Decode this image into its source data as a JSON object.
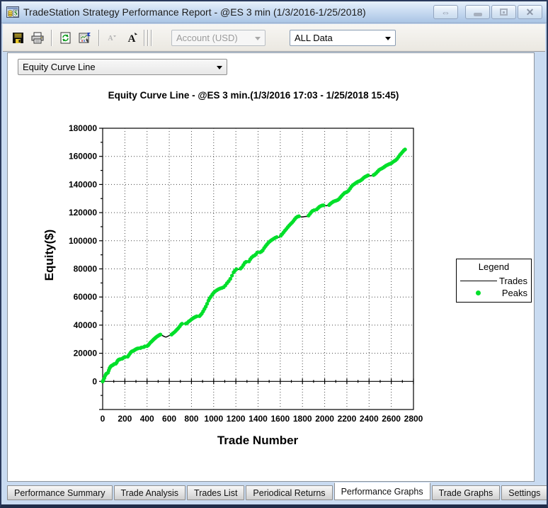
{
  "window": {
    "title": "TradeStation Strategy Performance Report - @ES 3 min (1/3/2016-1/25/2018)",
    "controls": [
      {
        "name": "dock-toggle",
        "icon": "left-right-arrow-icon",
        "glyph": "⇔"
      },
      {
        "name": "minimize",
        "icon": "minimize-icon"
      },
      {
        "name": "maximize",
        "icon": "maximize-icon"
      },
      {
        "name": "close",
        "icon": "close-icon",
        "glyph": "✕"
      }
    ]
  },
  "toolbar": {
    "buttons": [
      {
        "name": "save",
        "icon": "save-floppy-icon"
      },
      {
        "name": "print",
        "icon": "printer-icon"
      },
      {
        "name": "refresh",
        "icon": "refresh-page-icon"
      },
      {
        "name": "report-settings",
        "icon": "report-settings-icon"
      },
      {
        "name": "font-decrease",
        "icon": "font-decrease-icon",
        "disabled": true
      },
      {
        "name": "font-increase",
        "icon": "font-increase-icon"
      }
    ],
    "account_combo": {
      "value": "Account (USD)",
      "disabled": true
    },
    "range_combo": {
      "value": "ALL Data",
      "disabled": false
    }
  },
  "graph_selector": {
    "value": "Equity Curve Line"
  },
  "chart_data": {
    "type": "line",
    "title": "Equity Curve Line - @ES 3 min.(1/3/2016 17:03 - 1/25/2018 15:45)",
    "xlabel": "Trade Number",
    "ylabel": "Equity($)",
    "xlim": [
      0,
      2800
    ],
    "ylim": [
      -20000,
      180000
    ],
    "x_tick_step": 200,
    "x_minor_step": 100,
    "y_tick_step": 20000,
    "y_minor_step": 10000,
    "y_label_min": 0,
    "grid": "dotted",
    "grid_color": "#444444",
    "legend": {
      "title": "Legend",
      "position": "right-outside",
      "entries": [
        {
          "label": "Trades",
          "type": "line",
          "color": "#000000"
        },
        {
          "label": "Peaks",
          "type": "dot",
          "color": "#00df2a"
        }
      ]
    },
    "series": [
      {
        "name": "Trades",
        "type": "line",
        "color": "#000000",
        "points": [
          [
            0,
            0
          ],
          [
            8,
            1200
          ],
          [
            16,
            2600
          ],
          [
            24,
            4300
          ],
          [
            30,
            5200
          ],
          [
            36,
            5600
          ],
          [
            42,
            5100
          ],
          [
            48,
            6200
          ],
          [
            55,
            7800
          ],
          [
            62,
            9300
          ],
          [
            70,
            10400
          ],
          [
            78,
            11000
          ],
          [
            86,
            11400
          ],
          [
            95,
            11800
          ],
          [
            103,
            12300
          ],
          [
            110,
            12100
          ],
          [
            118,
            12600
          ],
          [
            126,
            13400
          ],
          [
            134,
            14600
          ],
          [
            142,
            15300
          ],
          [
            150,
            15600
          ],
          [
            158,
            15800
          ],
          [
            166,
            15700
          ],
          [
            175,
            16100
          ],
          [
            184,
            16600
          ],
          [
            193,
            17100
          ],
          [
            202,
            17300
          ],
          [
            210,
            16900
          ],
          [
            218,
            17000
          ],
          [
            226,
            17600
          ],
          [
            235,
            18600
          ],
          [
            244,
            19600
          ],
          [
            253,
            20600
          ],
          [
            262,
            21300
          ],
          [
            271,
            21600
          ],
          [
            280,
            21900
          ],
          [
            290,
            22400
          ],
          [
            300,
            22900
          ],
          [
            310,
            23300
          ],
          [
            320,
            23500
          ],
          [
            330,
            23100
          ],
          [
            340,
            23700
          ],
          [
            350,
            24100
          ],
          [
            360,
            23900
          ],
          [
            370,
            24400
          ],
          [
            380,
            24900
          ],
          [
            390,
            24600
          ],
          [
            400,
            25100
          ],
          [
            410,
            25700
          ],
          [
            420,
            26600
          ],
          [
            430,
            27600
          ],
          [
            440,
            28300
          ],
          [
            450,
            29100
          ],
          [
            460,
            29900
          ],
          [
            470,
            30600
          ],
          [
            480,
            31300
          ],
          [
            490,
            31900
          ],
          [
            500,
            32400
          ],
          [
            510,
            32900
          ],
          [
            520,
            33300
          ],
          [
            532,
            32900
          ],
          [
            545,
            32300
          ],
          [
            558,
            31800
          ],
          [
            570,
            31500
          ],
          [
            582,
            31900
          ],
          [
            595,
            32400
          ],
          [
            608,
            32900
          ],
          [
            620,
            33300
          ],
          [
            632,
            34100
          ],
          [
            645,
            34900
          ],
          [
            658,
            35900
          ],
          [
            670,
            36900
          ],
          [
            682,
            37900
          ],
          [
            695,
            39200
          ],
          [
            706,
            40400
          ],
          [
            715,
            41000
          ],
          [
            726,
            40800
          ],
          [
            738,
            40900
          ],
          [
            750,
            41100
          ],
          [
            762,
            41600
          ],
          [
            775,
            42600
          ],
          [
            788,
            43300
          ],
          [
            800,
            44100
          ],
          [
            812,
            44800
          ],
          [
            824,
            45400
          ],
          [
            836,
            45900
          ],
          [
            848,
            46300
          ],
          [
            860,
            46100
          ],
          [
            872,
            46400
          ],
          [
            882,
            47200
          ],
          [
            893,
            48200
          ],
          [
            905,
            49800
          ],
          [
            917,
            51500
          ],
          [
            929,
            53200
          ],
          [
            941,
            55200
          ],
          [
            953,
            57400
          ],
          [
            963,
            59000
          ],
          [
            975,
            60300
          ],
          [
            988,
            61800
          ],
          [
            1000,
            63000
          ],
          [
            1015,
            64100
          ],
          [
            1030,
            64900
          ],
          [
            1045,
            65600
          ],
          [
            1060,
            66100
          ],
          [
            1075,
            66500
          ],
          [
            1090,
            67000
          ],
          [
            1105,
            68200
          ],
          [
            1120,
            69800
          ],
          [
            1135,
            71200
          ],
          [
            1150,
            72900
          ],
          [
            1165,
            75200
          ],
          [
            1180,
            77600
          ],
          [
            1192,
            78800
          ],
          [
            1205,
            79800
          ],
          [
            1218,
            79500
          ],
          [
            1230,
            79700
          ],
          [
            1242,
            80200
          ],
          [
            1255,
            81200
          ],
          [
            1268,
            82800
          ],
          [
            1280,
            84300
          ],
          [
            1292,
            85000
          ],
          [
            1305,
            84800
          ],
          [
            1318,
            85300
          ],
          [
            1330,
            86900
          ],
          [
            1342,
            88100
          ],
          [
            1355,
            89000
          ],
          [
            1368,
            89500
          ],
          [
            1380,
            90300
          ],
          [
            1392,
            91600
          ],
          [
            1405,
            91400
          ],
          [
            1418,
            91800
          ],
          [
            1430,
            92300
          ],
          [
            1442,
            93200
          ],
          [
            1455,
            94800
          ],
          [
            1468,
            96200
          ],
          [
            1480,
            97400
          ],
          [
            1492,
            98500
          ],
          [
            1505,
            99500
          ],
          [
            1518,
            100300
          ],
          [
            1530,
            100900
          ],
          [
            1542,
            101500
          ],
          [
            1555,
            102100
          ],
          [
            1568,
            102600
          ],
          [
            1580,
            102400
          ],
          [
            1592,
            102500
          ],
          [
            1605,
            103600
          ],
          [
            1618,
            104800
          ],
          [
            1630,
            106000
          ],
          [
            1642,
            107200
          ],
          [
            1655,
            108400
          ],
          [
            1668,
            109700
          ],
          [
            1680,
            110800
          ],
          [
            1692,
            111800
          ],
          [
            1705,
            112800
          ],
          [
            1718,
            114000
          ],
          [
            1730,
            115300
          ],
          [
            1742,
            116400
          ],
          [
            1755,
            117100
          ],
          [
            1768,
            117400
          ],
          [
            1780,
            117200
          ],
          [
            1792,
            116900
          ],
          [
            1805,
            117000
          ],
          [
            1818,
            117200
          ],
          [
            1830,
            117300
          ],
          [
            1842,
            117300
          ],
          [
            1855,
            117900
          ],
          [
            1868,
            119200
          ],
          [
            1880,
            120400
          ],
          [
            1892,
            121300
          ],
          [
            1905,
            121700
          ],
          [
            1915,
            121500
          ],
          [
            1928,
            122300
          ],
          [
            1940,
            123200
          ],
          [
            1952,
            124100
          ],
          [
            1965,
            124700
          ],
          [
            1978,
            125100
          ],
          [
            1990,
            125200
          ],
          [
            2002,
            125000
          ],
          [
            2015,
            124900
          ],
          [
            2028,
            125100
          ],
          [
            2040,
            125400
          ],
          [
            2052,
            126300
          ],
          [
            2065,
            127100
          ],
          [
            2078,
            127800
          ],
          [
            2090,
            128200
          ],
          [
            2102,
            128500
          ],
          [
            2115,
            128900
          ],
          [
            2128,
            129600
          ],
          [
            2140,
            130700
          ],
          [
            2152,
            131800
          ],
          [
            2165,
            132900
          ],
          [
            2178,
            133900
          ],
          [
            2190,
            134400
          ],
          [
            2202,
            134800
          ],
          [
            2215,
            135600
          ],
          [
            2228,
            137000
          ],
          [
            2240,
            138400
          ],
          [
            2252,
            139500
          ],
          [
            2265,
            140200
          ],
          [
            2278,
            140900
          ],
          [
            2290,
            141600
          ],
          [
            2302,
            142100
          ],
          [
            2315,
            142500
          ],
          [
            2328,
            143100
          ],
          [
            2340,
            143900
          ],
          [
            2352,
            144800
          ],
          [
            2365,
            145500
          ],
          [
            2378,
            146000
          ],
          [
            2390,
            146500
          ],
          [
            2402,
            146300
          ],
          [
            2415,
            146200
          ],
          [
            2428,
            146400
          ],
          [
            2440,
            146700
          ],
          [
            2452,
            147300
          ],
          [
            2465,
            148200
          ],
          [
            2478,
            149300
          ],
          [
            2490,
            150300
          ],
          [
            2502,
            150900
          ],
          [
            2515,
            151400
          ],
          [
            2528,
            152000
          ],
          [
            2540,
            152700
          ],
          [
            2552,
            153400
          ],
          [
            2565,
            153900
          ],
          [
            2578,
            154400
          ],
          [
            2590,
            154800
          ],
          [
            2602,
            155200
          ],
          [
            2615,
            156000
          ],
          [
            2628,
            156700
          ],
          [
            2640,
            157300
          ],
          [
            2652,
            158200
          ],
          [
            2665,
            159600
          ],
          [
            2678,
            161000
          ],
          [
            2690,
            162100
          ],
          [
            2702,
            163200
          ],
          [
            2714,
            164300
          ],
          [
            2724,
            164900
          ]
        ]
      },
      {
        "name": "Peaks",
        "type": "running-max-dots",
        "color": "#00df2a",
        "derived_from": "Trades"
      }
    ]
  },
  "tabs": [
    {
      "label": "Performance Summary",
      "active": false
    },
    {
      "label": "Trade Analysis",
      "active": false
    },
    {
      "label": "Trades List",
      "active": false
    },
    {
      "label": "Periodical Returns",
      "active": false
    },
    {
      "label": "Performance Graphs",
      "active": true
    },
    {
      "label": "Trade Graphs",
      "active": false
    },
    {
      "label": "Settings",
      "active": false
    }
  ]
}
